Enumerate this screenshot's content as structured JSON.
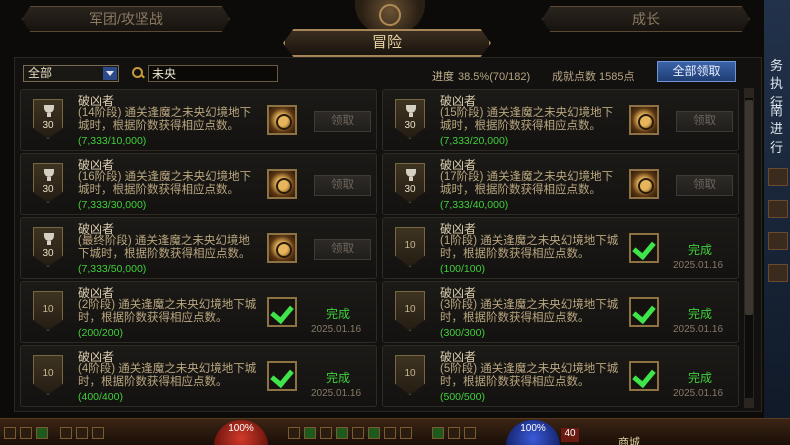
{
  "tabs": {
    "legion": "军团/攻坚战",
    "adventure": "冒险",
    "growth": "成长"
  },
  "filter": {
    "selected": "全部",
    "search_value": "未央"
  },
  "stats": {
    "progress_label": "进度",
    "progress_value": "38.5%(70/182)",
    "points_text": "成就点数 1585点"
  },
  "claim_all_label": "全部领取",
  "cards": [
    {
      "title": "破凶者",
      "desc": "(14阶段) 通关逢魔之未央幻境地下城时，根据阶数获得相应点数。",
      "progress": "(7,333/10,000)",
      "badge": "30",
      "status": "claim",
      "button": "领取",
      "date": ""
    },
    {
      "title": "破凶者",
      "desc": "(15阶段) 通关逢魔之未央幻境地下城时，根据阶数获得相应点数。",
      "progress": "(7,333/20,000)",
      "badge": "30",
      "status": "claim",
      "button": "领取",
      "date": ""
    },
    {
      "title": "破凶者",
      "desc": "(16阶段) 通关逢魔之未央幻境地下城时，根据阶数获得相应点数。",
      "progress": "(7,333/30,000)",
      "badge": "30",
      "status": "claim",
      "button": "领取",
      "date": ""
    },
    {
      "title": "破凶者",
      "desc": "(17阶段) 通关逢魔之未央幻境地下城时，根据阶数获得相应点数。",
      "progress": "(7,333/40,000)",
      "badge": "30",
      "status": "claim",
      "button": "领取",
      "date": ""
    },
    {
      "title": "破凶者",
      "desc": "(最终阶段) 通关逢魔之未央幻境地下城时，根据阶数获得相应点数。",
      "progress": "(7,333/50,000)",
      "badge": "30",
      "status": "claim",
      "button": "领取",
      "date": ""
    },
    {
      "title": "破凶者",
      "desc": "(1阶段) 通关逢魔之未央幻境地下城时，根据阶数获得相应点数。",
      "progress": "(100/100)",
      "badge": "10",
      "status": "done",
      "button": "完成",
      "date": "2025.01.16"
    },
    {
      "title": "破凶者",
      "desc": "(2阶段) 通关逢魔之未央幻境地下城时，根据阶数获得相应点数。",
      "progress": "(200/200)",
      "badge": "10",
      "status": "done",
      "button": "完成",
      "date": "2025.01.16"
    },
    {
      "title": "破凶者",
      "desc": "(3阶段) 通关逢魔之未央幻境地下城时，根据阶数获得相应点数。",
      "progress": "(300/300)",
      "badge": "10",
      "status": "done",
      "button": "完成",
      "date": "2025.01.16"
    },
    {
      "title": "破凶者",
      "desc": "(4阶段) 通关逢魔之未央幻境地下城时，根据阶数获得相应点数。",
      "progress": "(400/400)",
      "badge": "10",
      "status": "done",
      "button": "完成",
      "date": "2025.01.16"
    },
    {
      "title": "破凶者",
      "desc": "(5阶段) 通关逢魔之未央幻境地下城时，根据阶数获得相应点数。",
      "progress": "(500/500)",
      "badge": "10",
      "status": "done",
      "button": "完成",
      "date": "2025.01.16"
    }
  ],
  "side_text": {
    "line1": "务",
    "line2": "执行",
    "line3": "南",
    "line4": "进行"
  },
  "bottom": {
    "hp": "100%",
    "mp": "100%",
    "level": "40",
    "shop": "商城"
  }
}
